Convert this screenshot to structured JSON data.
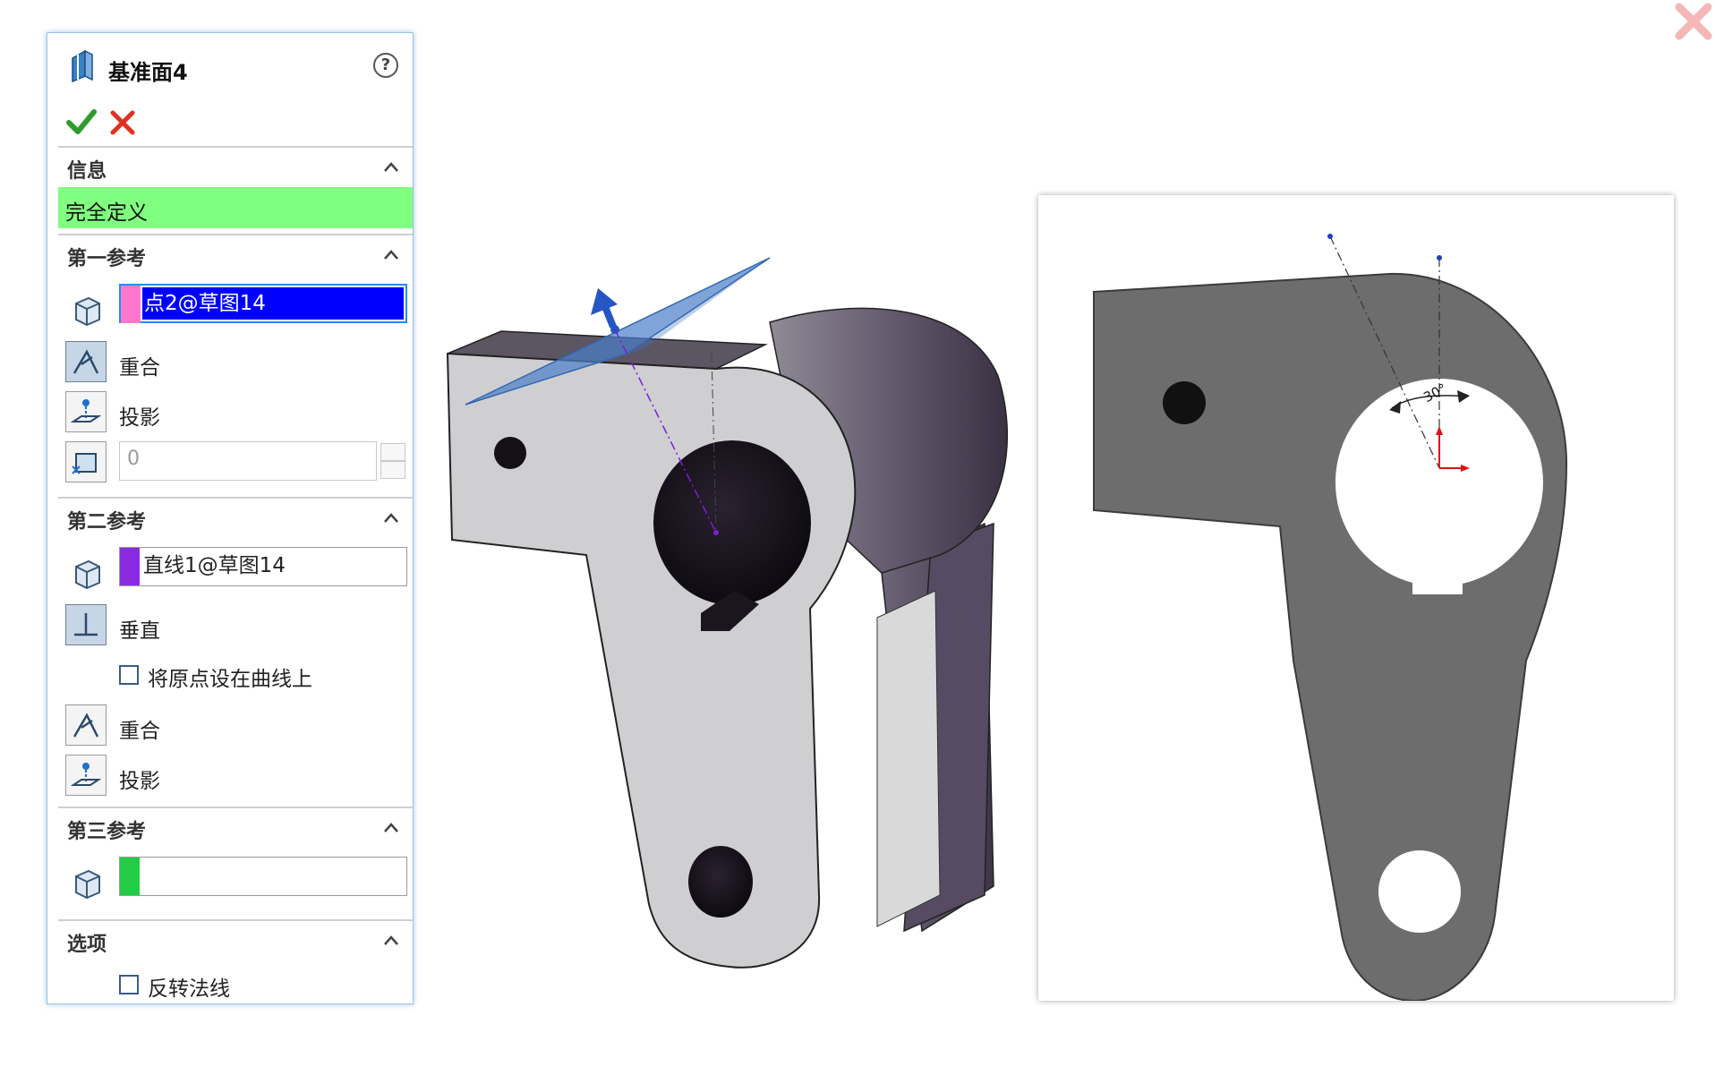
{
  "panel": {
    "title": "基准面4",
    "sections": {
      "info": {
        "label": "信息",
        "status": "完全定义"
      },
      "first_ref": {
        "label": "第一参考",
        "selection": "点2@草图14",
        "swatch": "#ff77cc",
        "options": [
          "重合",
          "投影"
        ],
        "distance_value": "0"
      },
      "second_ref": {
        "label": "第二参考",
        "selection": "直线1@草图14",
        "swatch": "#8a2be2",
        "options": [
          "垂直"
        ],
        "origin_checkbox": "将原点设在曲线上",
        "options2": [
          "重合",
          "投影"
        ]
      },
      "third_ref": {
        "label": "第三参考",
        "selection": "",
        "swatch": "#22cc44"
      },
      "options": {
        "label": "选项",
        "flip_checkbox": "反转法线"
      }
    }
  },
  "drawing": {
    "angle_label": "30°"
  },
  "colors": {
    "status_ok": "#80ff80",
    "accent": "#1c8fff",
    "selection_highlight": "#0000ff"
  },
  "icons": [
    "datum-plane-icon",
    "help-icon",
    "ok-icon",
    "cancel-icon",
    "collapse-chevron-icon",
    "reference-entity-icon",
    "coincident-icon",
    "project-icon",
    "distance-icon",
    "perpendicular-icon",
    "close-icon"
  ]
}
